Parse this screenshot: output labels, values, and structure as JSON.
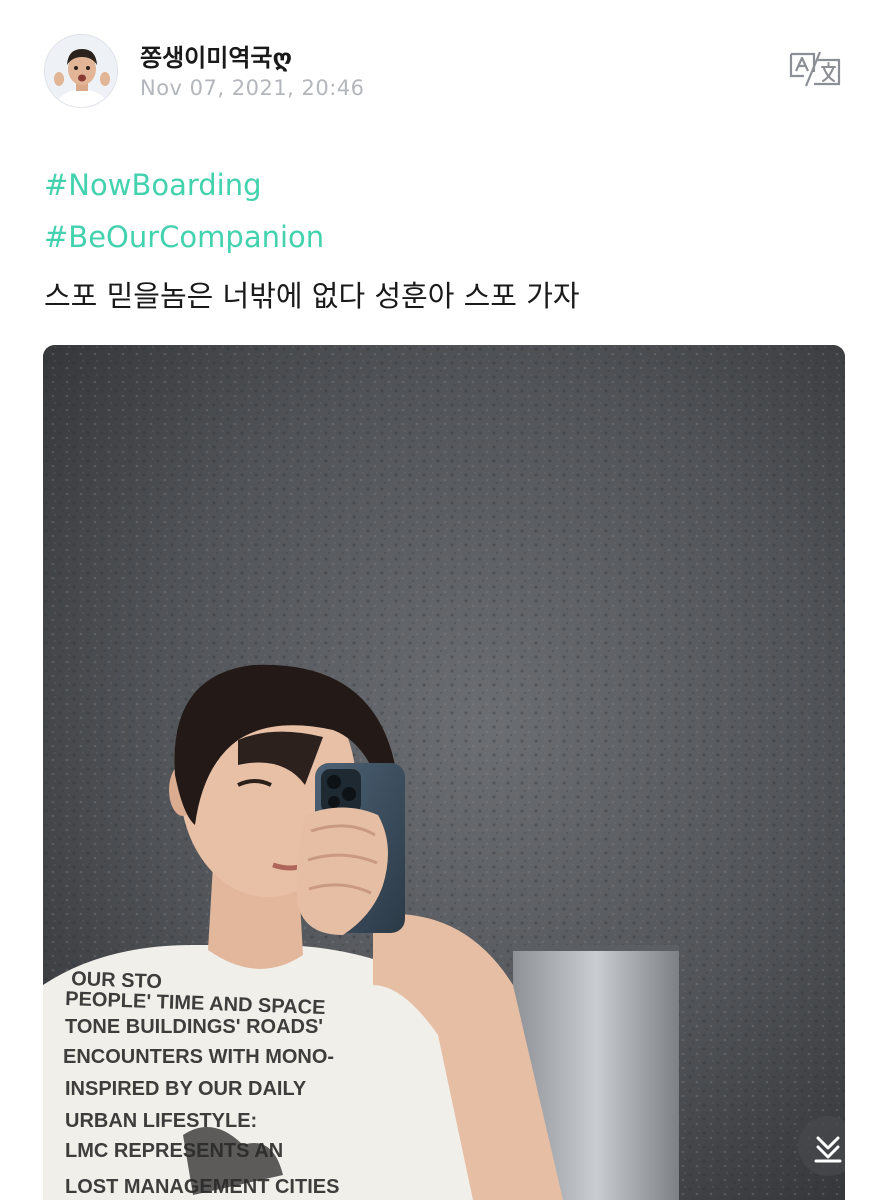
{
  "post": {
    "author": {
      "name": "쫑생이미역국ღ",
      "avatar_icon": "profile-photo"
    },
    "timestamp": "Nov 07, 2021, 20:46",
    "translate_icon": "translate-icon",
    "hashtags": [
      "#NowBoarding",
      "#BeOurCompanion"
    ],
    "text": "스포 믿을놈은 너밖에 없다 성훈아 스포 가자",
    "photo": {
      "description_icon": "post-photo",
      "shirt_text_lines": [
        "OUR STO",
        "PEOPLE' TIME AND SPACE",
        "TONE BUILDINGS' ROADS'",
        "ENCOUNTERS WITH MONO-",
        "INSPIRED BY OUR DAILY",
        "URBAN LIFESTYLE:",
        "LMC REPRESENTS AN",
        "LOST MANAGEMENT CITIES"
      ]
    },
    "scroll_icon": "scroll-down-icon"
  },
  "colors": {
    "hashtag": "#43d2ae",
    "timestamp": "#b3b6bb",
    "text": "#1a1a1a",
    "wall": "#4a4d51"
  }
}
